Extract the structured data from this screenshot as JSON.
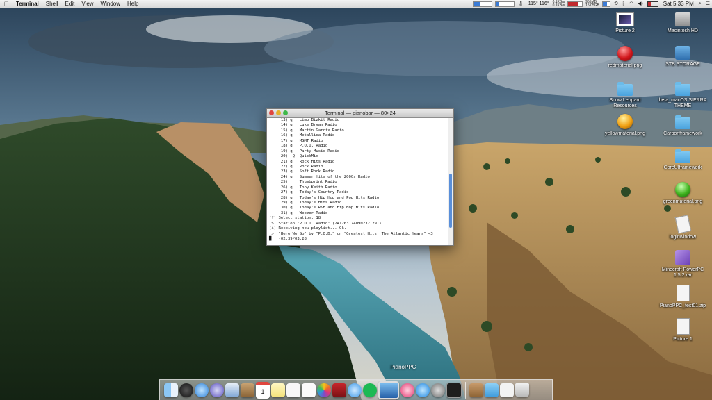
{
  "menubar": {
    "apple_icon": "apple-icon",
    "items": [
      "Terminal",
      "Shell",
      "Edit",
      "View",
      "Window",
      "Help"
    ],
    "temps": "115° 116°",
    "net_up": "0.1KB/s",
    "net_down": "0.1KB/s",
    "mem_top": "955MB",
    "mem_bottom": "15.05GB",
    "clock": "Sat 5:33 PM"
  },
  "terminal": {
    "title": "Terminal — pianobar — 80×24",
    "lines": [
      "     13) q   Limp Bizkit Radio",
      "     14) q   Luke Bryan Radio",
      "     15) q   Martin Garrix Radio",
      "     16) q   Metallica Radio",
      "     17) q   MGMT Radio",
      "     18) q   P.O.D. Radio",
      "     19) q   Party Music Radio",
      "     20)  Q  QuickMix",
      "     21) q   Rock Hits Radio",
      "     22) q   Rock Radio",
      "     23) q   Soft Rock Radio",
      "     24) q   Summer Hits of the 2000s Radio",
      "     25)     Thumbprint Radio",
      "     26) q   Toby Keith Radio",
      "     27) q   Today's Country Radio",
      "     28) q   Today's Hip Hop and Pop Hits Radio",
      "     29) q   Today's Hits Radio",
      "     30) q   Today's R&B and Hip Hop Hits Radio",
      "     31) q   Weezer Radio",
      "[?] Select station: 18",
      "|>  Station \"P.O.D. Radio\" (2412631740902321291)",
      "(i) Receiving new playlist... Ok.",
      "|>  \"Here We Go\" by \"P.O.D.\" on \"Greatest Hits: The Atlantic Years\" <3",
      "█   -02:39/03:28"
    ]
  },
  "desktop_icons": [
    {
      "label": "Picture 2",
      "icon": "picture-icon"
    },
    {
      "label": "Macintosh HD",
      "icon": "hard-drive-icon"
    },
    {
      "label": "redmaterial.png",
      "icon": "red-orb-icon"
    },
    {
      "label": "STB STORAGE",
      "icon": "network-drive-icon"
    },
    {
      "label": "Snow Leopard Resources",
      "icon": "folder-icon"
    },
    {
      "label": "beta_macOS SIERRA THEME",
      "icon": "folder-icon"
    },
    {
      "label": "yellowmaterial.png",
      "icon": "yellow-orb-icon"
    },
    {
      "label": "Carbonframework",
      "icon": "folder-icon"
    },
    {
      "label": "CoreUIframework",
      "icon": "folder-icon"
    },
    {
      "label": "greenmaterial.png",
      "icon": "green-orb-icon"
    },
    {
      "label": "loginwindow",
      "icon": "document-icon"
    },
    {
      "label": "Minecraft PowerPC 1.5.2.rar",
      "icon": "archive-icon"
    },
    {
      "label": "PianoPPC_test01.zip",
      "icon": "zip-icon"
    },
    {
      "label": "Picture 1",
      "icon": "picture-icon"
    }
  ],
  "dock": {
    "hover_label": "PianoPPC",
    "apps": [
      "finder-icon",
      "dashboard-icon",
      "safari-icon",
      "launchpad-icon",
      "preview-icon",
      "contacts-icon",
      "calendar-icon",
      "notes-icon",
      "textedit-icon",
      "reminders-icon",
      "photos-icon",
      "photobooth-icon",
      "messages-icon",
      "spotify-icon",
      "pianoppc-monitor-icon",
      "itunes-icon",
      "app-store-icon",
      "system-preferences-icon",
      "terminal-icon",
      "folder-icon",
      "downloads-folder-icon",
      "zip-icon",
      "trash-icon"
    ],
    "calendar_day": "1"
  },
  "colors": {
    "accent": "#3b7bd6",
    "close": "#e0463f",
    "minimize": "#e6b12a",
    "maximize": "#3fb94a"
  }
}
